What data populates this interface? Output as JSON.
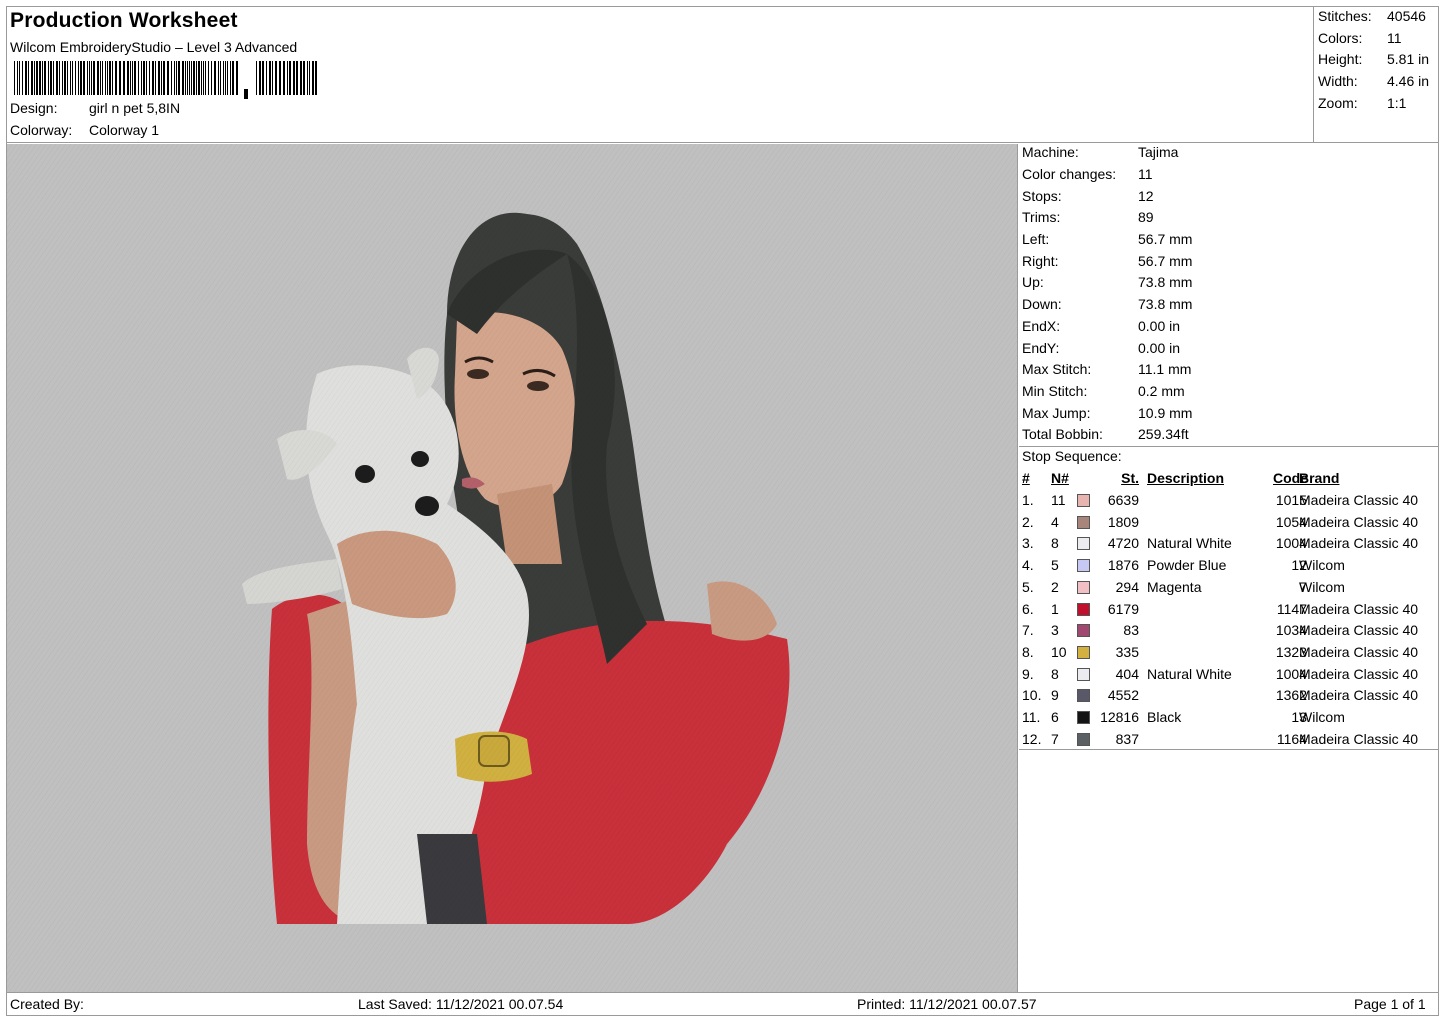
{
  "header": {
    "title": "Production Worksheet",
    "subtitle": "Wilcom EmbroideryStudio – Level 3 Advanced",
    "design_label": "Design:",
    "design_value": "girl n pet 5,8IN",
    "colorway_label": "Colorway:",
    "colorway_value": "Colorway 1"
  },
  "stats": [
    {
      "label": "Stitches:",
      "value": "40546"
    },
    {
      "label": "Colors:",
      "value": "11"
    },
    {
      "label": "Height:",
      "value": "5.81 in"
    },
    {
      "label": "Width:",
      "value": "4.46 in"
    },
    {
      "label": "Zoom:",
      "value": "1:1"
    }
  ],
  "machine": [
    {
      "label": "Machine:",
      "value": "Tajima"
    },
    {
      "label": "Color changes:",
      "value": "11"
    },
    {
      "label": "Stops:",
      "value": "12"
    },
    {
      "label": "Trims:",
      "value": "89"
    },
    {
      "label": "Left:",
      "value": "56.7 mm"
    },
    {
      "label": "Right:",
      "value": "56.7 mm"
    },
    {
      "label": "Up:",
      "value": "73.8 mm"
    },
    {
      "label": "Down:",
      "value": "73.8 mm"
    },
    {
      "label": "EndX:",
      "value": "0.00 in"
    },
    {
      "label": "EndY:",
      "value": "0.00 in"
    },
    {
      "label": "Max Stitch:",
      "value": "11.1 mm"
    },
    {
      "label": "Min Stitch:",
      "value": "0.2 mm"
    },
    {
      "label": "Max Jump:",
      "value": "10.9 mm"
    },
    {
      "label": "Total Bobbin:",
      "value": "259.34ft"
    }
  ],
  "stop_sequence": {
    "label": "Stop Sequence:",
    "headers": {
      "num": "#",
      "n": "N#",
      "st": "St.",
      "desc": "Description",
      "code": "Code",
      "brand": "Brand"
    },
    "rows": [
      {
        "num": "1.",
        "n": "11",
        "color": "#e8b4b0",
        "st": "6639",
        "desc": "",
        "code": "1015",
        "brand": "Madeira Classic 40"
      },
      {
        "num": "2.",
        "n": "4",
        "color": "#a8857a",
        "st": "1809",
        "desc": "",
        "code": "1054",
        "brand": "Madeira Classic 40"
      },
      {
        "num": "3.",
        "n": "8",
        "color": "#ececf0",
        "st": "4720",
        "desc": "Natural White",
        "code": "1004",
        "brand": "Madeira Classic 40"
      },
      {
        "num": "4.",
        "n": "5",
        "color": "#c8c8f4",
        "st": "1876",
        "desc": "Powder Blue",
        "code": "12",
        "brand": "Wilcom"
      },
      {
        "num": "5.",
        "n": "2",
        "color": "#f0c0c4",
        "st": "294",
        "desc": "Magenta",
        "code": "7",
        "brand": "Wilcom"
      },
      {
        "num": "6.",
        "n": "1",
        "color": "#c0102e",
        "st": "6179",
        "desc": "",
        "code": "1147",
        "brand": "Madeira Classic 40"
      },
      {
        "num": "7.",
        "n": "3",
        "color": "#a04870",
        "st": "83",
        "desc": "",
        "code": "1034",
        "brand": "Madeira Classic 40"
      },
      {
        "num": "8.",
        "n": "10",
        "color": "#d4b040",
        "st": "335",
        "desc": "",
        "code": "1323",
        "brand": "Madeira Classic 40"
      },
      {
        "num": "9.",
        "n": "8",
        "color": "#ececf0",
        "st": "404",
        "desc": "Natural White",
        "code": "1004",
        "brand": "Madeira Classic 40"
      },
      {
        "num": "10.",
        "n": "9",
        "color": "#585868",
        "st": "4552",
        "desc": "",
        "code": "1362",
        "brand": "Madeira Classic 40"
      },
      {
        "num": "11.",
        "n": "6",
        "color": "#141414",
        "st": "12816",
        "desc": "Black",
        "code": "13",
        "brand": "Wilcom"
      },
      {
        "num": "12.",
        "n": "7",
        "color": "#5a6064",
        "st": "837",
        "desc": "",
        "code": "1164",
        "brand": "Madeira Classic 40"
      }
    ]
  },
  "footer": {
    "created_by": "Created By:",
    "last_saved": "Last Saved: 11/12/2021 00.07.54",
    "printed": "Printed: 11/12/2021 00.07.57",
    "page": "Page 1 of 1"
  }
}
